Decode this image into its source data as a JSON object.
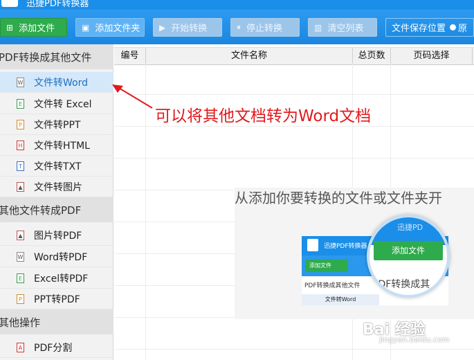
{
  "titlebar": {
    "title": "迅捷PDF转换器"
  },
  "toolbar": {
    "add_file": "添加文件",
    "add_folder": "添加文件夹",
    "start_convert": "开始转换",
    "stop_convert": "停止转换",
    "clear_list": "清空列表",
    "save_location": "文件保存位置",
    "save_radio_label": "原"
  },
  "sidebar": {
    "sections": [
      {
        "title": "PDF转换成其他文件",
        "items": [
          {
            "label": "文件转Word",
            "icon": "W"
          },
          {
            "label": "文件转 Excel",
            "icon": "E"
          },
          {
            "label": "文件转PPT",
            "icon": "P"
          },
          {
            "label": "文件转HTML",
            "icon": "H"
          },
          {
            "label": "文件转TXT",
            "icon": "T"
          },
          {
            "label": "文件转图片",
            "icon": "img"
          }
        ]
      },
      {
        "title": "其他文件转成PDF",
        "items": [
          {
            "label": "图片转PDF",
            "icon": "img"
          },
          {
            "label": "Word转PDF",
            "icon": "W"
          },
          {
            "label": "Excel转PDF",
            "icon": "E"
          },
          {
            "label": "PPT转PDF",
            "icon": "P"
          }
        ]
      },
      {
        "title": "其他操作",
        "items": [
          {
            "label": "PDF分割",
            "icon": "pdf"
          }
        ]
      }
    ]
  },
  "table": {
    "columns": [
      "编号",
      "文件名称",
      "总页数",
      "页码选择"
    ]
  },
  "annotation": {
    "text": "可以将其他文档转为Word文档"
  },
  "help": {
    "caption": "从添加你要转换的文件或文件夹开",
    "mini_title": "迅捷PDF转换器",
    "mini_add": "添加文件",
    "mini_section": "PDF转换成其他文件",
    "mini_item": "文件转Word",
    "mag_title": "迅捷PD",
    "mag_button": "添加文件",
    "mag_section": "PDF转换成其"
  },
  "watermark": {
    "brand": "Bai 经验",
    "url": "jingyan.baidu.com"
  },
  "colors": {
    "toolbar": "#1b86df",
    "green": "#2eab4c",
    "annotation": "#e2191d",
    "active": "#d5e8fa"
  }
}
